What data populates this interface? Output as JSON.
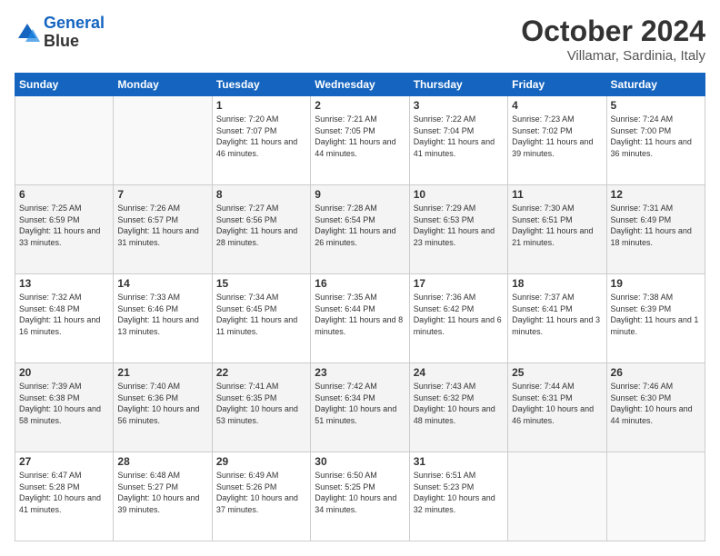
{
  "header": {
    "logo_line1": "General",
    "logo_line2": "Blue",
    "month": "October 2024",
    "location": "Villamar, Sardinia, Italy"
  },
  "days_of_week": [
    "Sunday",
    "Monday",
    "Tuesday",
    "Wednesday",
    "Thursday",
    "Friday",
    "Saturday"
  ],
  "weeks": [
    [
      {
        "num": "",
        "info": ""
      },
      {
        "num": "",
        "info": ""
      },
      {
        "num": "1",
        "info": "Sunrise: 7:20 AM\nSunset: 7:07 PM\nDaylight: 11 hours and 46 minutes."
      },
      {
        "num": "2",
        "info": "Sunrise: 7:21 AM\nSunset: 7:05 PM\nDaylight: 11 hours and 44 minutes."
      },
      {
        "num": "3",
        "info": "Sunrise: 7:22 AM\nSunset: 7:04 PM\nDaylight: 11 hours and 41 minutes."
      },
      {
        "num": "4",
        "info": "Sunrise: 7:23 AM\nSunset: 7:02 PM\nDaylight: 11 hours and 39 minutes."
      },
      {
        "num": "5",
        "info": "Sunrise: 7:24 AM\nSunset: 7:00 PM\nDaylight: 11 hours and 36 minutes."
      }
    ],
    [
      {
        "num": "6",
        "info": "Sunrise: 7:25 AM\nSunset: 6:59 PM\nDaylight: 11 hours and 33 minutes."
      },
      {
        "num": "7",
        "info": "Sunrise: 7:26 AM\nSunset: 6:57 PM\nDaylight: 11 hours and 31 minutes."
      },
      {
        "num": "8",
        "info": "Sunrise: 7:27 AM\nSunset: 6:56 PM\nDaylight: 11 hours and 28 minutes."
      },
      {
        "num": "9",
        "info": "Sunrise: 7:28 AM\nSunset: 6:54 PM\nDaylight: 11 hours and 26 minutes."
      },
      {
        "num": "10",
        "info": "Sunrise: 7:29 AM\nSunset: 6:53 PM\nDaylight: 11 hours and 23 minutes."
      },
      {
        "num": "11",
        "info": "Sunrise: 7:30 AM\nSunset: 6:51 PM\nDaylight: 11 hours and 21 minutes."
      },
      {
        "num": "12",
        "info": "Sunrise: 7:31 AM\nSunset: 6:49 PM\nDaylight: 11 hours and 18 minutes."
      }
    ],
    [
      {
        "num": "13",
        "info": "Sunrise: 7:32 AM\nSunset: 6:48 PM\nDaylight: 11 hours and 16 minutes."
      },
      {
        "num": "14",
        "info": "Sunrise: 7:33 AM\nSunset: 6:46 PM\nDaylight: 11 hours and 13 minutes."
      },
      {
        "num": "15",
        "info": "Sunrise: 7:34 AM\nSunset: 6:45 PM\nDaylight: 11 hours and 11 minutes."
      },
      {
        "num": "16",
        "info": "Sunrise: 7:35 AM\nSunset: 6:44 PM\nDaylight: 11 hours and 8 minutes."
      },
      {
        "num": "17",
        "info": "Sunrise: 7:36 AM\nSunset: 6:42 PM\nDaylight: 11 hours and 6 minutes."
      },
      {
        "num": "18",
        "info": "Sunrise: 7:37 AM\nSunset: 6:41 PM\nDaylight: 11 hours and 3 minutes."
      },
      {
        "num": "19",
        "info": "Sunrise: 7:38 AM\nSunset: 6:39 PM\nDaylight: 11 hours and 1 minute."
      }
    ],
    [
      {
        "num": "20",
        "info": "Sunrise: 7:39 AM\nSunset: 6:38 PM\nDaylight: 10 hours and 58 minutes."
      },
      {
        "num": "21",
        "info": "Sunrise: 7:40 AM\nSunset: 6:36 PM\nDaylight: 10 hours and 56 minutes."
      },
      {
        "num": "22",
        "info": "Sunrise: 7:41 AM\nSunset: 6:35 PM\nDaylight: 10 hours and 53 minutes."
      },
      {
        "num": "23",
        "info": "Sunrise: 7:42 AM\nSunset: 6:34 PM\nDaylight: 10 hours and 51 minutes."
      },
      {
        "num": "24",
        "info": "Sunrise: 7:43 AM\nSunset: 6:32 PM\nDaylight: 10 hours and 48 minutes."
      },
      {
        "num": "25",
        "info": "Sunrise: 7:44 AM\nSunset: 6:31 PM\nDaylight: 10 hours and 46 minutes."
      },
      {
        "num": "26",
        "info": "Sunrise: 7:46 AM\nSunset: 6:30 PM\nDaylight: 10 hours and 44 minutes."
      }
    ],
    [
      {
        "num": "27",
        "info": "Sunrise: 6:47 AM\nSunset: 5:28 PM\nDaylight: 10 hours and 41 minutes."
      },
      {
        "num": "28",
        "info": "Sunrise: 6:48 AM\nSunset: 5:27 PM\nDaylight: 10 hours and 39 minutes."
      },
      {
        "num": "29",
        "info": "Sunrise: 6:49 AM\nSunset: 5:26 PM\nDaylight: 10 hours and 37 minutes."
      },
      {
        "num": "30",
        "info": "Sunrise: 6:50 AM\nSunset: 5:25 PM\nDaylight: 10 hours and 34 minutes."
      },
      {
        "num": "31",
        "info": "Sunrise: 6:51 AM\nSunset: 5:23 PM\nDaylight: 10 hours and 32 minutes."
      },
      {
        "num": "",
        "info": ""
      },
      {
        "num": "",
        "info": ""
      }
    ]
  ]
}
